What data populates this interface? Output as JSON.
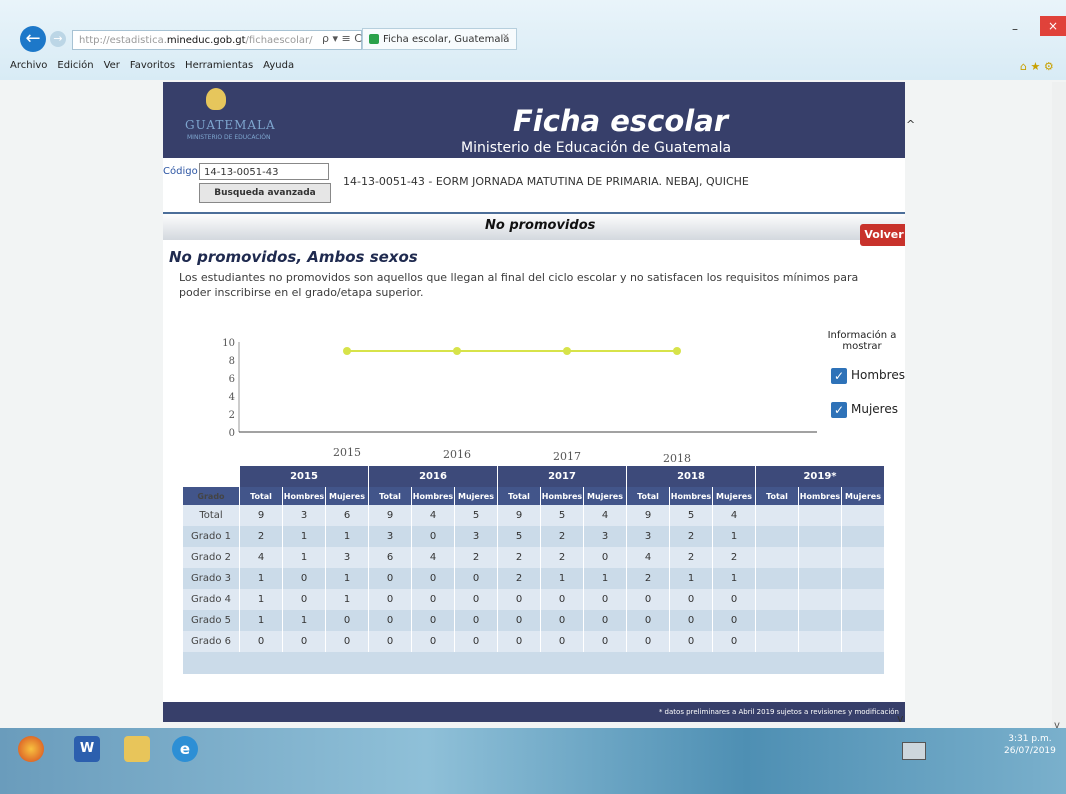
{
  "browser": {
    "url_prefix": "http://estadistica.",
    "url_domain": "mineduc.gob.gt",
    "url_suffix": "/fichaescolar/",
    "url_tools": "ρ ▾ ≡ C",
    "tab_title": "Ficha escolar, Guatemala",
    "tab_close": "×",
    "back_icon": "arrow-left-icon",
    "menu": [
      "Archivo",
      "Edición",
      "Ver",
      "Favoritos",
      "Herramientas",
      "Ayuda"
    ],
    "min": "–",
    "close": "×",
    "toolbar_icons": "⌂ ★ ⚙"
  },
  "header": {
    "logo_text": "GUATEMALA",
    "logo_sub": "MINISTERIO DE EDUCACIÓN",
    "title": "Ficha escolar",
    "subtitle": "Ministerio de Educación de Guatemala"
  },
  "search": {
    "codigo_label": "Código",
    "codigo_value": "14-13-0051-43",
    "busqueda_label": "Busqueda avanzada",
    "school": "14-13-0051-43 - EORM JORNADA MATUTINA DE PRIMARIA. NEBAJ, QUICHE"
  },
  "section": {
    "title": "No promovidos",
    "volver": "Volver",
    "content_title": "No promovidos, Ambos sexos",
    "description": "Los estudiantes no promovidos son aquellos que llegan al final del ciclo escolar y no satisfacen los requisitos mínimos para poder inscribirse en el grado/etapa superior."
  },
  "legend": {
    "title": "Información a mostrar",
    "hombres": "Hombres",
    "mujeres": "Mujeres",
    "check": "✓"
  },
  "chart_data": {
    "type": "line",
    "x": [
      "2015",
      "2016",
      "2017",
      "2018"
    ],
    "series": [
      {
        "values": [
          9,
          9,
          9,
          9
        ]
      }
    ],
    "ylim": [
      0,
      10
    ],
    "yticks": [
      "0",
      "2",
      "4",
      "6",
      "8",
      "10"
    ],
    "line_color": "#d7e34a",
    "grid": false
  },
  "table": {
    "grade_header": "Grado",
    "years": [
      "2015",
      "2016",
      "2017",
      "2018",
      "2019*"
    ],
    "sub_headers": [
      "Total",
      "Hombres",
      "Mujeres"
    ],
    "rows": [
      {
        "grade": "Total",
        "cells": [
          "9",
          "3",
          "6",
          "9",
          "4",
          "5",
          "9",
          "5",
          "4",
          "9",
          "5",
          "4",
          "",
          "",
          ""
        ]
      },
      {
        "grade": "Grado 1",
        "cells": [
          "2",
          "1",
          "1",
          "3",
          "0",
          "3",
          "5",
          "2",
          "3",
          "3",
          "2",
          "1",
          "",
          "",
          ""
        ]
      },
      {
        "grade": "Grado 2",
        "cells": [
          "4",
          "1",
          "3",
          "6",
          "4",
          "2",
          "2",
          "2",
          "0",
          "4",
          "2",
          "2",
          "",
          "",
          ""
        ]
      },
      {
        "grade": "Grado 3",
        "cells": [
          "1",
          "0",
          "1",
          "0",
          "0",
          "0",
          "2",
          "1",
          "1",
          "2",
          "1",
          "1",
          "",
          "",
          ""
        ]
      },
      {
        "grade": "Grado 4",
        "cells": [
          "1",
          "0",
          "1",
          "0",
          "0",
          "0",
          "0",
          "0",
          "0",
          "0",
          "0",
          "0",
          "",
          "",
          ""
        ]
      },
      {
        "grade": "Grado 5",
        "cells": [
          "1",
          "1",
          "0",
          "0",
          "0",
          "0",
          "0",
          "0",
          "0",
          "0",
          "0",
          "0",
          "",
          "",
          ""
        ]
      },
      {
        "grade": "Grado 6",
        "cells": [
          "0",
          "0",
          "0",
          "0",
          "0",
          "0",
          "0",
          "0",
          "0",
          "0",
          "0",
          "0",
          "",
          "",
          ""
        ]
      }
    ]
  },
  "footer": {
    "note": "* datos preliminares a Abril 2019 sujetos a revisiones y modificación"
  },
  "scroll": {
    "up": "^",
    "down": "v"
  },
  "taskbar": {
    "word": "W",
    "ie": "e",
    "time": "3:31 p.m.",
    "date": "26/07/2019"
  }
}
